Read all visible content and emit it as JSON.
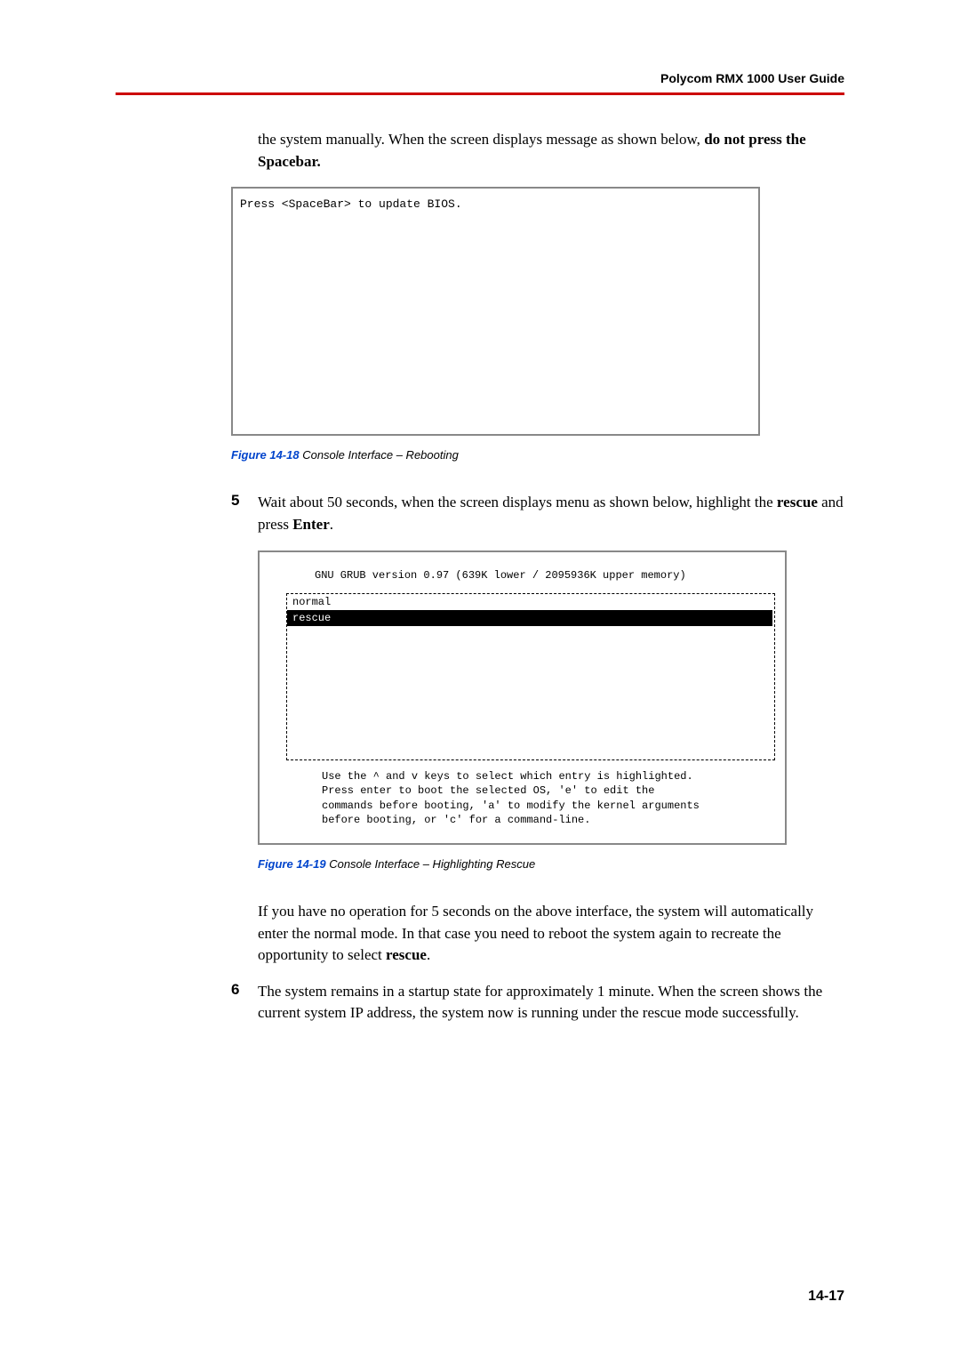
{
  "header": {
    "title": "Polycom RMX 1000 User Guide"
  },
  "intro": {
    "line1": "the system manually. When the screen displays message as shown below, ",
    "bold1": "do not press the Spacebar."
  },
  "screenshot1": {
    "text": "Press <SpaceBar> to update BIOS."
  },
  "figure1": {
    "num": "Figure 14-18",
    "caption": " Console Interface – Rebooting"
  },
  "step5": {
    "num": "5",
    "text1": "Wait about 50 seconds, when the screen displays menu as shown below, highlight the ",
    "bold1": "rescue",
    "text2": " and press ",
    "bold2": "Enter",
    "text3": "."
  },
  "grub": {
    "title": "GNU GRUB  version 0.97  (639K lower / 2095936K upper memory)",
    "item_normal": " normal",
    "item_rescue": " rescue",
    "help1": "Use the ^ and v keys to select which entry is highlighted.",
    "help2": "Press enter to boot the selected OS, 'e' to edit the",
    "help3": "commands before booting, 'a' to modify the kernel arguments",
    "help4": "before booting, or 'c' for a command-line."
  },
  "figure2": {
    "num": "Figure 14-19",
    "caption": " Console Interface – Highlighting Rescue"
  },
  "after5": {
    "text1": "If you have no operation for 5 seconds on the above interface, the system will automatically enter the normal mode. In that case you need to reboot the system again to recreate the opportunity to select ",
    "bold1": "rescue",
    "text2": "."
  },
  "step6": {
    "num": "6",
    "text": "The system remains in a startup state for approximately 1 minute. When the screen shows the current system IP address, the system now is running under the rescue mode successfully."
  },
  "footer": {
    "pagenum": "14-17"
  }
}
